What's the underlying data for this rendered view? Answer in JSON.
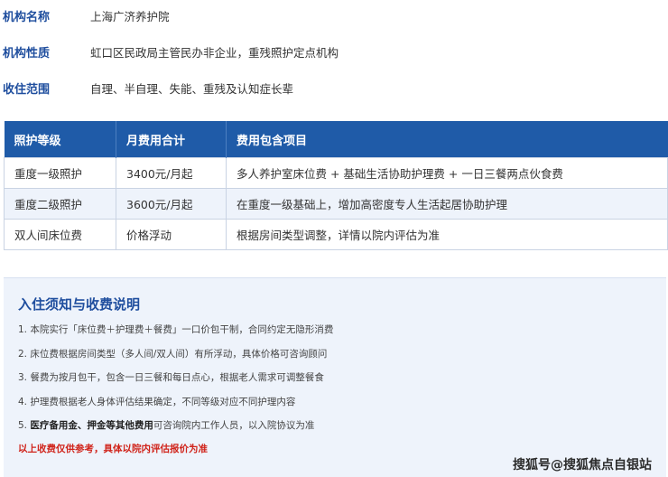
{
  "info": [
    {
      "label": "机构名称",
      "value": "上海广济养护院"
    },
    {
      "label": "机构性质",
      "value": "虹口区民政局主管民办非企业，重残照护定点机构"
    },
    {
      "label": "收住范围",
      "value": "自理、半自理、失能、重残及认知症长辈"
    }
  ],
  "fee_table": {
    "headers": [
      "照护等级",
      "月费用合计",
      "费用包含项目"
    ],
    "rows": [
      [
        "重度一级照护",
        "3400元/月起",
        "多人养护室床位费 + 基础生活协助护理费 + 一日三餐两点伙食费"
      ],
      [
        "重度二级照护",
        "3600元/月起",
        "在重度一级基础上，增加高密度专人生活起居协助护理"
      ],
      [
        "双人间床位费",
        "价格浮动",
        "根据房间类型调整，详情以院内评估为准"
      ]
    ]
  },
  "notice": {
    "title": "入住须知与收费说明",
    "items": [
      {
        "bold": "",
        "text": "1. 本院实行「床位费＋护理费＋餐费」一口价包干制，合同约定无隐形消费"
      },
      {
        "bold": "",
        "text": "2. 床位费根据房间类型（多人间/双人间）有所浮动，具体价格可咨询顾问"
      },
      {
        "bold": "",
        "text": "3. 餐费为按月包干，包含一日三餐和每日点心，根据老人需求可调整餐食"
      },
      {
        "bold": "",
        "text": "4. 护理费根据老人身体评估结果确定，不同等级对应不同护理内容"
      },
      {
        "prefix": "5. ",
        "bold": "医疗备用金、押金等其他费用",
        "text": "可咨询院内工作人员，以入院协议为准"
      }
    ],
    "warning": "以上收费仅供参考，具体以院内评估报价为准",
    "watermark": "搜狐号@搜狐焦点自银站"
  }
}
